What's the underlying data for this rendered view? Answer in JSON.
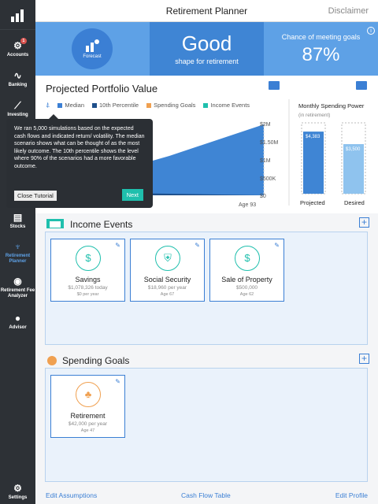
{
  "app": {
    "title": "Retirement Planner",
    "disclaimer": "Disclaimer"
  },
  "sidebar": {
    "items": [
      {
        "label": "Accounts",
        "icon": "accounts-icon",
        "badge": "1"
      },
      {
        "label": "Banking",
        "icon": "banking-icon"
      },
      {
        "label": "Investing",
        "icon": "investing-icon"
      },
      {
        "label": "Stocks",
        "icon": "stocks-icon"
      },
      {
        "label": "Retirement Planner",
        "icon": "retirement-planner-icon",
        "active": true
      },
      {
        "label": "Retirement Fee Analyzer",
        "icon": "fee-analyzer-icon"
      },
      {
        "label": "Advisor",
        "icon": "advisor-icon"
      }
    ],
    "settings_label": "Settings"
  },
  "hero": {
    "forecast_label": "Forecast",
    "status_word": "Good",
    "status_sub": "shape for retirement",
    "chance_label": "Chance of meeting goals",
    "chance_value": "87%"
  },
  "portfolio": {
    "title": "Projected Portfolio Value",
    "legend": [
      {
        "label": "Median",
        "color": "#3b7fd4"
      },
      {
        "label": "10th Percentile",
        "color": "#1e4f8a"
      },
      {
        "label": "Spending Goals",
        "color": "#f0a050"
      },
      {
        "label": "Income Events",
        "color": "#1fbfad"
      }
    ],
    "y_ticks": [
      "$2M",
      "$1.50M",
      "$1M",
      "$500K",
      "$0"
    ],
    "x_label": "Age 93"
  },
  "chart_data": {
    "type": "bar",
    "title": "Monthly Spending Power",
    "subtitle": "(in retirement)",
    "categories": [
      "Projected",
      "Desired"
    ],
    "values": [
      4383,
      3500
    ],
    "value_labels": [
      "$4,383",
      "$3,500"
    ]
  },
  "tooltip": {
    "text": "We ran 5,000 simulations based on the expected cash flows and indicated return/ volatility. The median scenario shows what can be thought of as the most likely outcome. The 10th percentile shows the level where 90% of the scenarios had a more favorable outcome.",
    "close_label": "Close Tutorial",
    "next_label": "Next"
  },
  "income": {
    "title": "Income Events",
    "cards": [
      {
        "name": "Savings",
        "sub": "$1,078,326 today",
        "sub2": "$0 per year",
        "icon": "dollar-icon"
      },
      {
        "name": "Social Security",
        "sub": "$18,960 per year",
        "sub2": "Age 67",
        "icon": "shield-icon"
      },
      {
        "name": "Sale of Property",
        "sub": "$500,000",
        "sub2": "Age 62",
        "icon": "property-icon"
      }
    ]
  },
  "spending": {
    "title": "Spending Goals",
    "cards": [
      {
        "name": "Retirement",
        "sub": "$42,000 per year",
        "sub2": "Age 47",
        "icon": "palm-tree-icon"
      }
    ]
  },
  "footer": {
    "edit_assumptions": "Edit Assumptions",
    "cash_flow": "Cash Flow Table",
    "edit_profile": "Edit Profile"
  }
}
